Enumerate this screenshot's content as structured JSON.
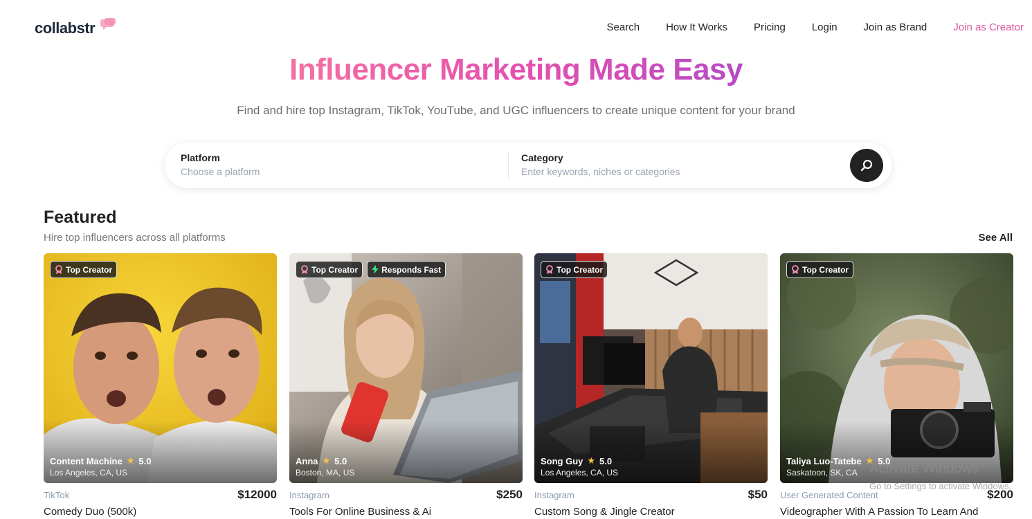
{
  "header": {
    "logo": "collabstr",
    "nav": [
      {
        "label": "Search"
      },
      {
        "label": "How It Works"
      },
      {
        "label": "Pricing"
      },
      {
        "label": "Login"
      },
      {
        "label": "Join as Brand"
      },
      {
        "label": "Join as Creator"
      }
    ]
  },
  "hero": {
    "title": "Influencer Marketing Made Easy",
    "subtitle": "Find and hire top Instagram, TikTok, YouTube, and UGC influencers to create unique content for your brand"
  },
  "search": {
    "platform_label": "Platform",
    "platform_placeholder": "Choose a platform",
    "category_label": "Category",
    "category_placeholder": "Enter keywords, niches or categories"
  },
  "featured": {
    "title": "Featured",
    "subtitle": "Hire top influencers across all platforms",
    "see_all": "See All",
    "cards": [
      {
        "badges": [
          "Top Creator"
        ],
        "name": "Content Machine",
        "rating": "5.0",
        "location": "Los Angeles, CA, US",
        "platform": "TikTok",
        "price": "$12000",
        "title": "Comedy Duo (500k)"
      },
      {
        "badges": [
          "Top Creator",
          "Responds Fast"
        ],
        "name": "Anna",
        "rating": "5.0",
        "location": "Boston, MA, US",
        "platform": "Instagram",
        "price": "$250",
        "title": "Tools For Online Business & Ai"
      },
      {
        "badges": [
          "Top Creator"
        ],
        "name": "Song Guy",
        "rating": "5.0",
        "location": "Los Angeles, CA, US",
        "platform": "Instagram",
        "price": "$50",
        "title": "Custom Song & Jingle Creator"
      },
      {
        "badges": [
          "Top Creator"
        ],
        "name": "Taliya Luo-Tatebe",
        "rating": "5.0",
        "location": "Saskatoon, SK, CA",
        "platform": "User Generated Content",
        "price": "$200",
        "title": "Videographer With A Passion To Learn And"
      }
    ]
  },
  "watermark": {
    "line1": "Activate Windows",
    "line2": "Go to Settings to activate Windows."
  },
  "colors": {
    "accent": "#e0559e",
    "gradient_start": "#f56fa0",
    "gradient_end": "#b64bc6",
    "search_button": "#222222"
  }
}
